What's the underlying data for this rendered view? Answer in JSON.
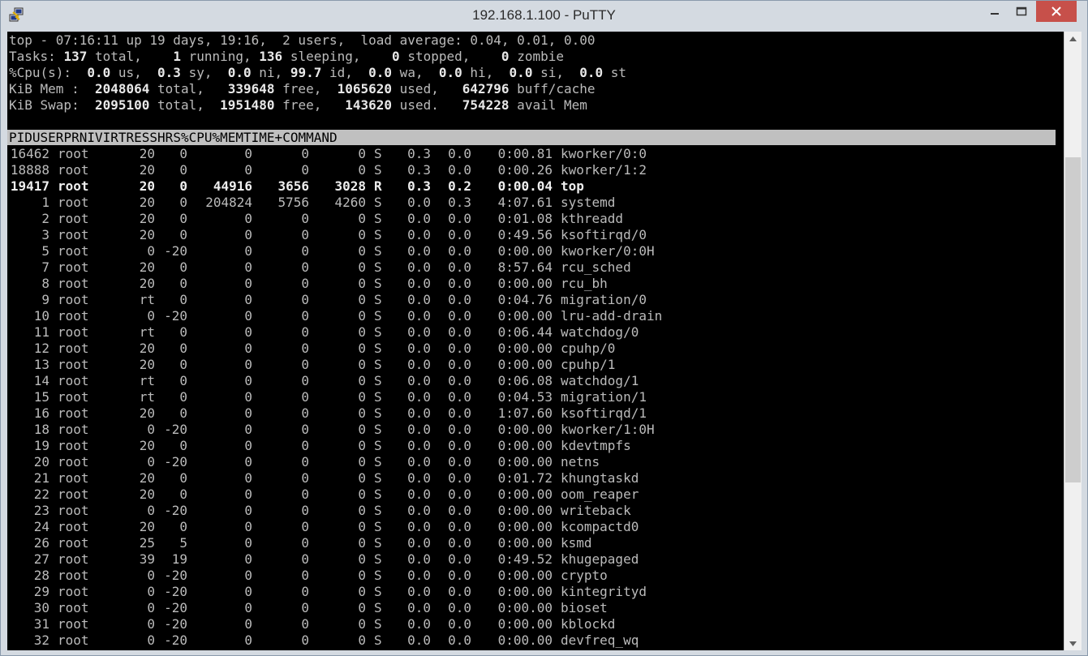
{
  "window": {
    "title": "192.168.1.100 - PuTTY",
    "app_icon": "putty-icon",
    "controls": [
      "minimize-icon",
      "maximize-icon",
      "close-icon"
    ]
  },
  "colors": {
    "terminal_bg": "#000000",
    "terminal_fg": "#bbbbbb",
    "header_bg": "#c0c0c0",
    "close_btn": "#c7504a"
  },
  "summary": {
    "line1": {
      "prefix": "top - 07:16:11 up 19 days, 19:16,  2 users,  load average: ",
      "load": "0.04, 0.01, 0.00"
    },
    "tasks": {
      "label": "Tasks:",
      "total": "137",
      "running": "1",
      "sleeping": "136",
      "stopped": "0",
      "zombie": "0"
    },
    "cpu": {
      "label": "%Cpu(s):",
      "us": "0.0",
      "sy": "0.3",
      "ni": "0.0",
      "id": "99.7",
      "wa": "0.0",
      "hi": "0.0",
      "si": "0.0",
      "st": "0.0"
    },
    "mem": {
      "label": "KiB Mem :",
      "total": "2048064",
      "free": "339648",
      "used": "1065620",
      "buff_cache": "642796"
    },
    "swap": {
      "label": "KiB Swap:",
      "total": "2095100",
      "free": "1951480",
      "used": "143620",
      "avail": "754228"
    }
  },
  "table": {
    "columns": [
      "PID",
      "USER",
      "PR",
      "NI",
      "VIRT",
      "RES",
      "SHR",
      "S",
      "%CPU",
      "%MEM",
      "TIME+",
      "COMMAND"
    ],
    "rows": [
      [
        "16462",
        "root",
        "20",
        "0",
        "0",
        "0",
        "0",
        "S",
        "0.3",
        "0.0",
        "0:00.81",
        "kworker/0:0"
      ],
      [
        "18888",
        "root",
        "20",
        "0",
        "0",
        "0",
        "0",
        "S",
        "0.3",
        "0.0",
        "0:00.26",
        "kworker/1:2"
      ],
      [
        "19417",
        "root",
        "20",
        "0",
        "44916",
        "3656",
        "3028",
        "R",
        "0.3",
        "0.2",
        "0:00.04",
        "top"
      ],
      [
        "1",
        "root",
        "20",
        "0",
        "204824",
        "5756",
        "4260",
        "S",
        "0.0",
        "0.3",
        "4:07.61",
        "systemd"
      ],
      [
        "2",
        "root",
        "20",
        "0",
        "0",
        "0",
        "0",
        "S",
        "0.0",
        "0.0",
        "0:01.08",
        "kthreadd"
      ],
      [
        "3",
        "root",
        "20",
        "0",
        "0",
        "0",
        "0",
        "S",
        "0.0",
        "0.0",
        "0:49.56",
        "ksoftirqd/0"
      ],
      [
        "5",
        "root",
        "0",
        "-20",
        "0",
        "0",
        "0",
        "S",
        "0.0",
        "0.0",
        "0:00.00",
        "kworker/0:0H"
      ],
      [
        "7",
        "root",
        "20",
        "0",
        "0",
        "0",
        "0",
        "S",
        "0.0",
        "0.0",
        "8:57.64",
        "rcu_sched"
      ],
      [
        "8",
        "root",
        "20",
        "0",
        "0",
        "0",
        "0",
        "S",
        "0.0",
        "0.0",
        "0:00.00",
        "rcu_bh"
      ],
      [
        "9",
        "root",
        "rt",
        "0",
        "0",
        "0",
        "0",
        "S",
        "0.0",
        "0.0",
        "0:04.76",
        "migration/0"
      ],
      [
        "10",
        "root",
        "0",
        "-20",
        "0",
        "0",
        "0",
        "S",
        "0.0",
        "0.0",
        "0:00.00",
        "lru-add-drain"
      ],
      [
        "11",
        "root",
        "rt",
        "0",
        "0",
        "0",
        "0",
        "S",
        "0.0",
        "0.0",
        "0:06.44",
        "watchdog/0"
      ],
      [
        "12",
        "root",
        "20",
        "0",
        "0",
        "0",
        "0",
        "S",
        "0.0",
        "0.0",
        "0:00.00",
        "cpuhp/0"
      ],
      [
        "13",
        "root",
        "20",
        "0",
        "0",
        "0",
        "0",
        "S",
        "0.0",
        "0.0",
        "0:00.00",
        "cpuhp/1"
      ],
      [
        "14",
        "root",
        "rt",
        "0",
        "0",
        "0",
        "0",
        "S",
        "0.0",
        "0.0",
        "0:06.08",
        "watchdog/1"
      ],
      [
        "15",
        "root",
        "rt",
        "0",
        "0",
        "0",
        "0",
        "S",
        "0.0",
        "0.0",
        "0:04.53",
        "migration/1"
      ],
      [
        "16",
        "root",
        "20",
        "0",
        "0",
        "0",
        "0",
        "S",
        "0.0",
        "0.0",
        "1:07.60",
        "ksoftirqd/1"
      ],
      [
        "18",
        "root",
        "0",
        "-20",
        "0",
        "0",
        "0",
        "S",
        "0.0",
        "0.0",
        "0:00.00",
        "kworker/1:0H"
      ],
      [
        "19",
        "root",
        "20",
        "0",
        "0",
        "0",
        "0",
        "S",
        "0.0",
        "0.0",
        "0:00.00",
        "kdevtmpfs"
      ],
      [
        "20",
        "root",
        "0",
        "-20",
        "0",
        "0",
        "0",
        "S",
        "0.0",
        "0.0",
        "0:00.00",
        "netns"
      ],
      [
        "21",
        "root",
        "20",
        "0",
        "0",
        "0",
        "0",
        "S",
        "0.0",
        "0.0",
        "0:01.72",
        "khungtaskd"
      ],
      [
        "22",
        "root",
        "20",
        "0",
        "0",
        "0",
        "0",
        "S",
        "0.0",
        "0.0",
        "0:00.00",
        "oom_reaper"
      ],
      [
        "23",
        "root",
        "0",
        "-20",
        "0",
        "0",
        "0",
        "S",
        "0.0",
        "0.0",
        "0:00.00",
        "writeback"
      ],
      [
        "24",
        "root",
        "20",
        "0",
        "0",
        "0",
        "0",
        "S",
        "0.0",
        "0.0",
        "0:00.00",
        "kcompactd0"
      ],
      [
        "26",
        "root",
        "25",
        "5",
        "0",
        "0",
        "0",
        "S",
        "0.0",
        "0.0",
        "0:00.00",
        "ksmd"
      ],
      [
        "27",
        "root",
        "39",
        "19",
        "0",
        "0",
        "0",
        "S",
        "0.0",
        "0.0",
        "0:49.52",
        "khugepaged"
      ],
      [
        "28",
        "root",
        "0",
        "-20",
        "0",
        "0",
        "0",
        "S",
        "0.0",
        "0.0",
        "0:00.00",
        "crypto"
      ],
      [
        "29",
        "root",
        "0",
        "-20",
        "0",
        "0",
        "0",
        "S",
        "0.0",
        "0.0",
        "0:00.00",
        "kintegrityd"
      ],
      [
        "30",
        "root",
        "0",
        "-20",
        "0",
        "0",
        "0",
        "S",
        "0.0",
        "0.0",
        "0:00.00",
        "bioset"
      ],
      [
        "31",
        "root",
        "0",
        "-20",
        "0",
        "0",
        "0",
        "S",
        "0.0",
        "0.0",
        "0:00.00",
        "kblockd"
      ],
      [
        "32",
        "root",
        "0",
        "-20",
        "0",
        "0",
        "0",
        "S",
        "0.0",
        "0.0",
        "0:00.00",
        "devfreq_wq"
      ]
    ],
    "bold_row_index": 2
  },
  "scrollbar": {
    "position_fraction": 0.42,
    "visible_fraction": 0.55
  }
}
